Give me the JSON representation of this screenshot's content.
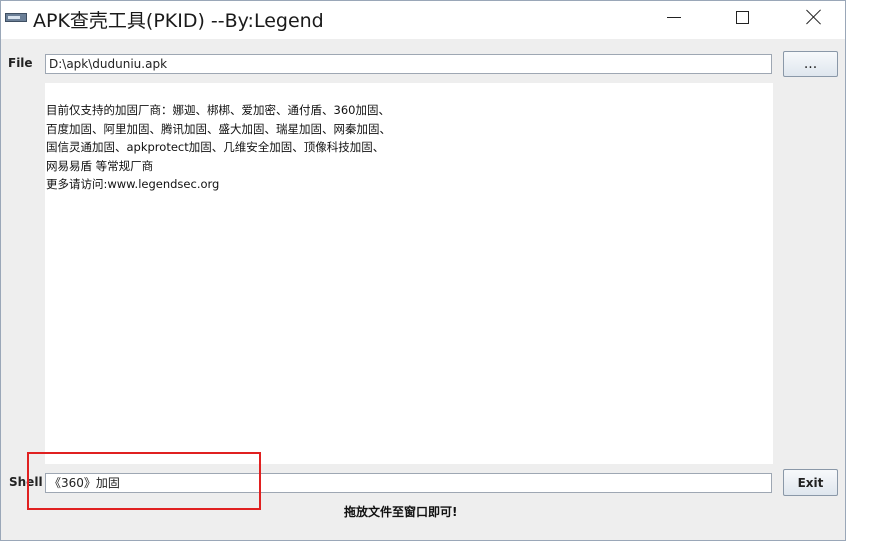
{
  "window": {
    "title": "APK查壳工具(PKID) --By:Legend"
  },
  "file": {
    "label": "File",
    "path": "D:\\apk\\duduniu.apk",
    "browse_label": "..."
  },
  "info": {
    "lines": [
      "目前仅支持的加固厂商：娜迦、梆梆、爱加密、通付盾、360加固、",
      "百度加固、阿里加固、腾讯加固、盛大加固、瑞星加固、网秦加固、",
      "国信灵通加固、apkprotect加固、几维安全加固、顶像科技加固、",
      "网易易盾 等常规厂商",
      "更多请访问:www.legendsec.org"
    ]
  },
  "shell": {
    "label": "Shell",
    "result": "《360》加固",
    "exit_label": "Exit"
  },
  "hint": "拖放文件至窗口即可!",
  "colors": {
    "highlight": "#e02020"
  }
}
